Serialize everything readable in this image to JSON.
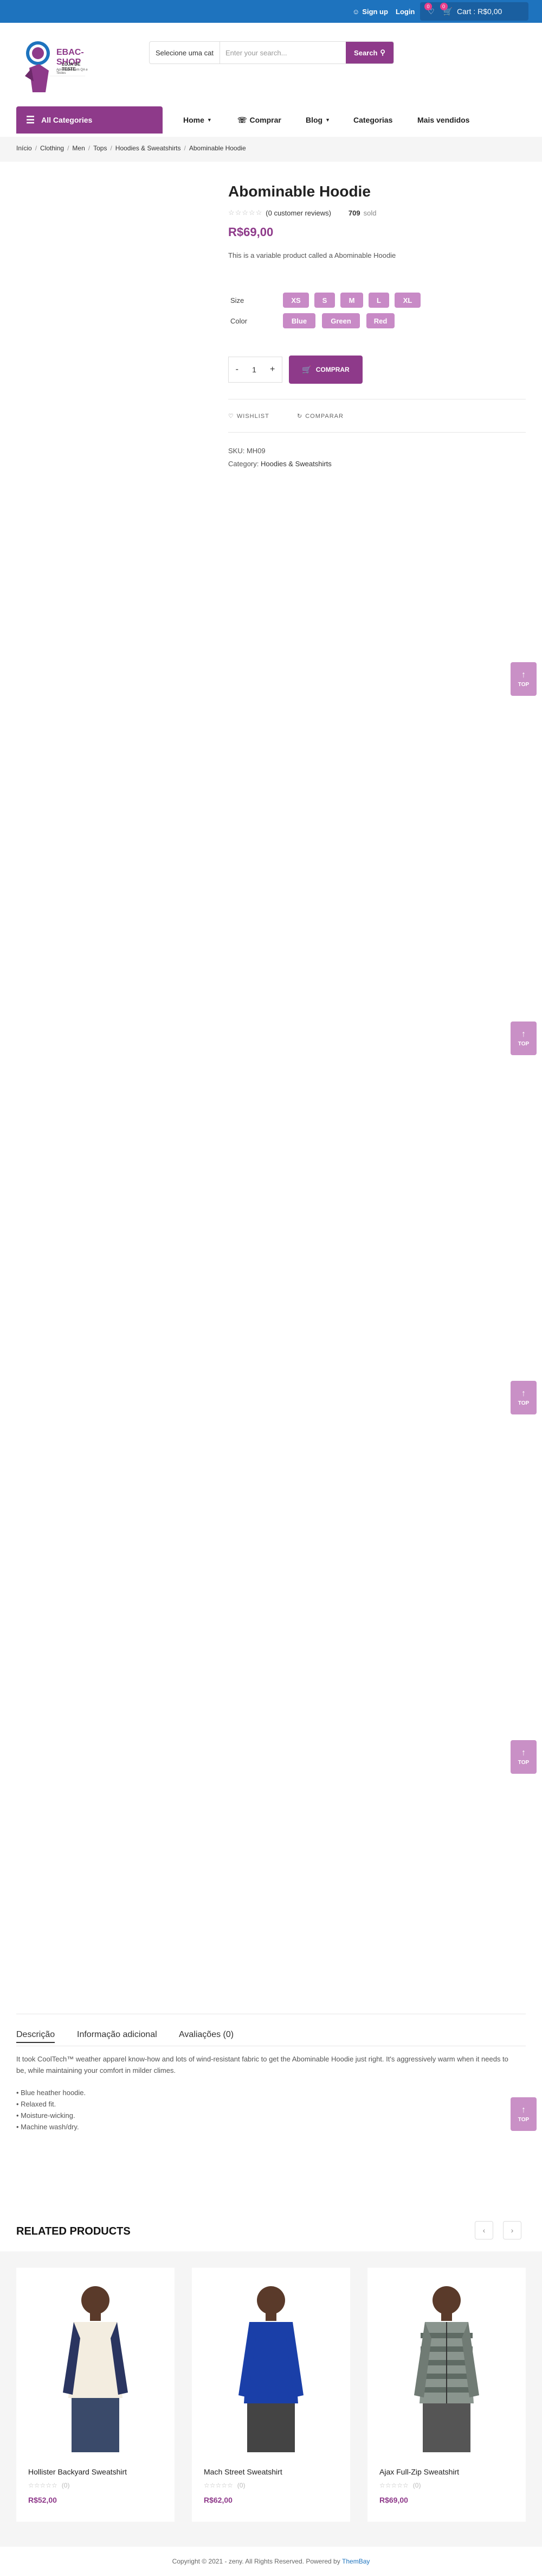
{
  "topbar": {
    "signup": "Sign up",
    "login": "Login",
    "cart": "Cart : R$0,00",
    "wishlist_count": "0",
    "cart_count": "0"
  },
  "logo": {
    "title": "EBAC-SHOP",
    "subtitle": "LOJA DE TESTE",
    "tagline": "Aprendendo em QA e Testes"
  },
  "search": {
    "category": "Selecione uma cat",
    "placeholder": "Enter your search...",
    "button": "Search"
  },
  "nav": {
    "all_categories": "All Categories",
    "items": [
      "Home",
      "Comprar",
      "Blog",
      "Categorias",
      "Mais vendidos"
    ]
  },
  "breadcrumb": [
    "Início",
    "Clothing",
    "Men",
    "Tops",
    "Hoodies & Sweatshirts",
    "Abominable Hoodie"
  ],
  "product": {
    "title": "Abominable Hoodie",
    "reviews": "(0 customer reviews)",
    "sold_count": "709",
    "sold_label": "sold",
    "price": "R$69,00",
    "short_description": "This is a variable product called a Abominable Hoodie",
    "size_label": "Size",
    "sizes": [
      "XS",
      "S",
      "M",
      "L",
      "XL"
    ],
    "color_label": "Color",
    "colors": [
      "Blue",
      "Green",
      "Red"
    ],
    "qty": "1",
    "buy_label": "COMPRAR",
    "wishlist": "WISHLIST",
    "compare": "COMPARAR",
    "sku_label": "SKU:",
    "sku": "MH09",
    "category_label": "Category:",
    "category": "Hoodies & Sweatshirts"
  },
  "top_label": "TOP",
  "tabs": [
    "Descrição",
    "Informação adicional",
    "Avaliações (0)"
  ],
  "description": {
    "paragraph": "It took CoolTech™ weather apparel know-how and lots of wind-resistant fabric to get the Abominable Hoodie just right. It's aggressively warm when it needs to be, while maintaining your comfort in milder climes.",
    "bullets": [
      "• Blue heather hoodie.",
      "• Relaxed fit.",
      "• Moisture-wicking.",
      "• Machine wash/dry."
    ]
  },
  "related": {
    "title": "RELATED PRODUCTS",
    "items": [
      {
        "name": "Hollister Backyard Sweatshirt",
        "reviews": "(0)",
        "price": "R$52,00"
      },
      {
        "name": "Mach Street Sweatshirt",
        "reviews": "(0)",
        "price": "R$62,00"
      },
      {
        "name": "Ajax Full-Zip Sweatshirt",
        "reviews": "(0)",
        "price": "R$69,00"
      }
    ]
  },
  "footer": {
    "text": "Copyright © 2021 - zeny. All Rights Reserved. Powered by",
    "link": "ThemBay"
  },
  "colors": {
    "primary": "#8e3a8a",
    "swatch": "#c88ac6",
    "topbar": "#1e73be"
  }
}
